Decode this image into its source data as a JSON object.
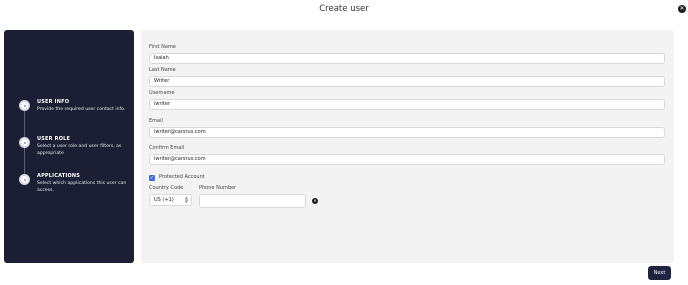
{
  "dialog": {
    "title": "Create user",
    "close_icon": "close-icon"
  },
  "steps": [
    {
      "title": "USER INFO",
      "description": "Provide the required user contact info."
    },
    {
      "title": "USER ROLE",
      "description": "Select a user role and user filters, as appropriate"
    },
    {
      "title": "APPLICATIONS",
      "description": "Select which applications this user can access."
    }
  ],
  "form": {
    "first_name": {
      "label": "First Name",
      "value": "Isaiah"
    },
    "last_name": {
      "label": "Last Name",
      "value": "Writer"
    },
    "username": {
      "label": "Username",
      "value": "iwriter"
    },
    "email": {
      "label": "Email",
      "value": "iwriter@carsrus.com"
    },
    "confirm_email": {
      "label": "Confirm Email",
      "value": "iwriter@carsrus.com"
    },
    "protected_account": {
      "label": "Protected Account",
      "checked": true
    },
    "country_code": {
      "label": "Country Code",
      "value": "US (+1)"
    },
    "phone_number": {
      "label": "Phone Number",
      "value": ""
    }
  },
  "footer": {
    "next_label": "Next"
  },
  "colors": {
    "sidebar": "#1c1f33",
    "accent": "#3f6cdf",
    "button": "#1f2340"
  }
}
